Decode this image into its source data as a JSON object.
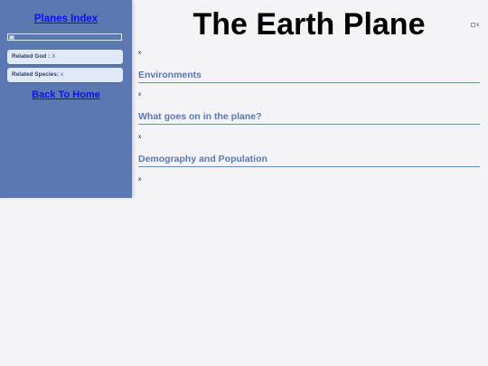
{
  "sidebar": {
    "title": "Planes Index",
    "related_god": {
      "label": "Related God :",
      "value": " X"
    },
    "related_species": {
      "label": "Related Species:",
      "value": " x"
    },
    "back_home": "Back To Home"
  },
  "main": {
    "title": "The Earth Plane",
    "header_image_alt": "x",
    "intro": "x",
    "sections": [
      {
        "heading": "Environments",
        "text": "x"
      },
      {
        "heading": "What goes on in the plane?",
        "text": "x"
      },
      {
        "heading": "Demography and Population",
        "text": "x"
      }
    ]
  },
  "colors": {
    "sidebar_bg": "#5b78b3",
    "page_bg": "#f3f3f8",
    "link": "#1010ee",
    "heading": "#5b78b3"
  }
}
